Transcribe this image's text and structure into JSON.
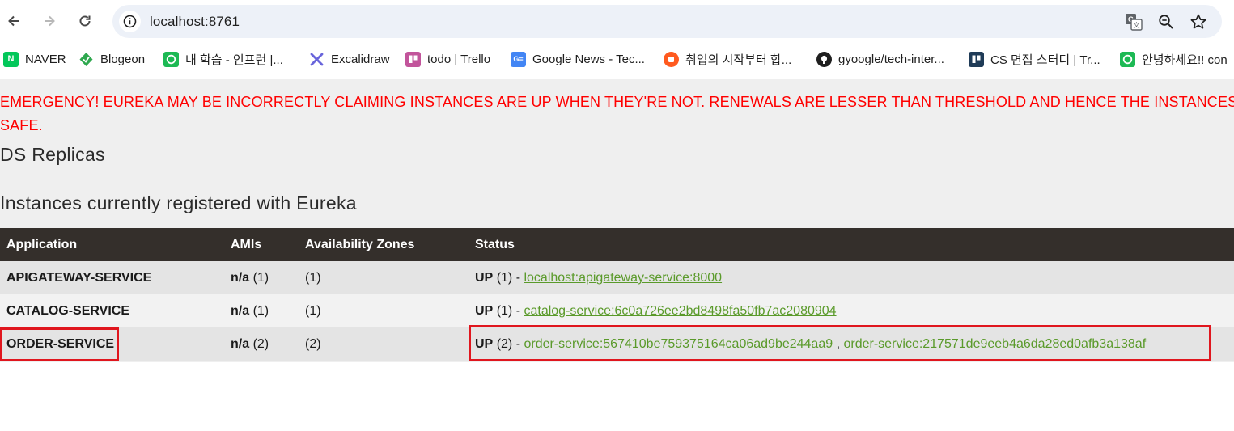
{
  "browser": {
    "url": "localhost:8761",
    "bookmarks": [
      {
        "label": "NAVER",
        "icon": "naver-icon",
        "color": "#03c75a"
      },
      {
        "label": "Blogeon",
        "icon": "blogeon-icon",
        "color": "#2fa84f"
      },
      {
        "label": "내 학습 - 인프런 |...",
        "icon": "inflearn-icon",
        "color": "#1db954"
      },
      {
        "label": "Excalidraw",
        "icon": "excalidraw-icon",
        "color": "#6965db"
      },
      {
        "label": "todo | Trello",
        "icon": "trello-icon",
        "color": "#c2549b"
      },
      {
        "label": "Google News - Tec...",
        "icon": "google-news-icon",
        "color": "#4285f4"
      },
      {
        "label": "취업의 시작부터 합...",
        "icon": "job-site-icon",
        "color": "#ff5a1f"
      },
      {
        "label": "gyoogle/tech-inter...",
        "icon": "github-icon",
        "color": "#1f1f1f"
      },
      {
        "label": "CS 면접 스터디 | Tr...",
        "icon": "trello-board-icon",
        "color": "#1f3b57"
      },
      {
        "label": "안녕하세요!! con",
        "icon": "inflearn-icon",
        "color": "#1db954"
      }
    ]
  },
  "page": {
    "emergency": "EMERGENCY! EUREKA MAY BE INCORRECTLY CLAIMING INSTANCES ARE UP WHEN THEY'RE NOT. RENEWALS ARE LESSER THAN THRESHOLD AND HENCE THE INSTANCES ARE NOT BEING EXPIRED JUST TO BE SAFE.",
    "emergency_line1": "EMERGENCY! EUREKA MAY BE INCORRECTLY CLAIMING INSTANCES ARE UP WHEN THEY'RE NOT. RENEWALS ARE LESSER THAN THRESHOLD AND HENCE THE INSTANCES",
    "emergency_line2": "SAFE.",
    "ds_replicas": "DS Replicas",
    "instances_heading": "Instances currently registered with Eureka",
    "table": {
      "headers": [
        "Application",
        "AMIs",
        "Availability Zones",
        "Status"
      ],
      "rows": [
        {
          "app": "APIGATEWAY-SERVICE",
          "ami": "n/a",
          "ami_count": "(1)",
          "az": "(1)",
          "status": "UP",
          "status_count": "(1) -",
          "links": [
            "localhost:apigateway-service:8000"
          ]
        },
        {
          "app": "CATALOG-SERVICE",
          "ami": "n/a",
          "ami_count": "(1)",
          "az": "(1)",
          "status": "UP",
          "status_count": "(1) -",
          "links": [
            "catalog-service:6c0a726ee2bd8498fa50fb7ac2080904"
          ]
        },
        {
          "app": "ORDER-SERVICE",
          "ami": "n/a",
          "ami_count": "(2)",
          "az": "(2)",
          "status": "UP",
          "status_count": "(2) -",
          "links": [
            "order-service:567410be759375164ca06ad9be244aa9",
            "order-service:217571de9eeb4a6da28ed0afb3a138af"
          ],
          "separator": ","
        }
      ]
    }
  }
}
